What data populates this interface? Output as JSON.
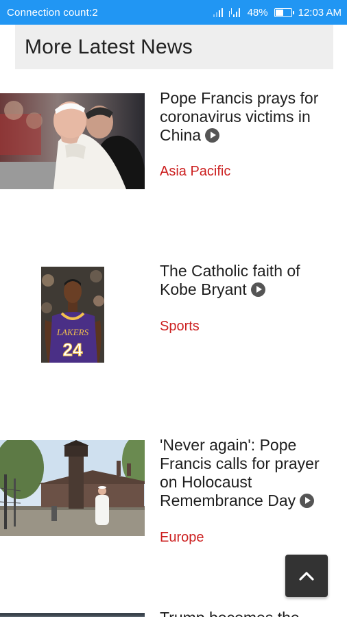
{
  "status_bar": {
    "left_text": "Connection count:2",
    "battery": "48%",
    "battery_level": 0.48,
    "time": "12:03 AM",
    "icons": [
      "signal-icon",
      "data-signal-icon",
      "battery-icon"
    ]
  },
  "section": {
    "title": "More Latest News"
  },
  "news": [
    {
      "headline": "Pope Francis prays for coronavirus victims in China",
      "category": "Asia Pacific",
      "image": "pope-francis-photo"
    },
    {
      "headline": "The Catholic faith of Kobe Bryant",
      "category": "Sports",
      "image": "kobe-bryant-photo"
    },
    {
      "headline": "'Never again': Pope Francis calls for prayer on Holocaust Remembrance Day",
      "category": "Europe",
      "image": "auschwitz-photo"
    },
    {
      "headline": "Trump becomes the",
      "category": "",
      "image": "partial-photo"
    }
  ],
  "colors": {
    "status_bar": "#2196f3",
    "category": "#cc1f1f",
    "header_bg": "#eeeeee",
    "scroll_button": "#333333"
  },
  "scroll_top": {
    "icon": "chevron-up-icon"
  }
}
